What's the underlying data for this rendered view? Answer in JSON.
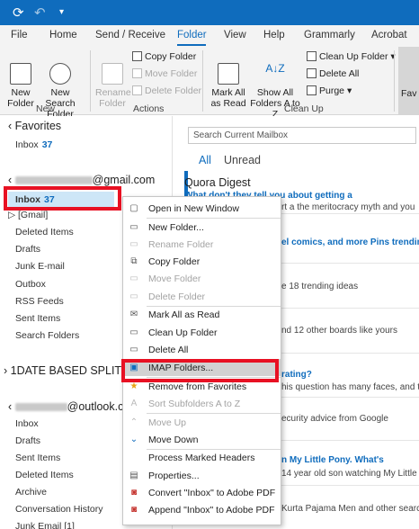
{
  "colors": {
    "accent": "#0f6cbd",
    "highlight_outline": "#e81123",
    "titlebar": "#0f6cbd"
  },
  "menu_tabs": [
    "File",
    "Home",
    "Send / Receive",
    "Folder",
    "View",
    "Help",
    "Grammarly",
    "Acrobat"
  ],
  "active_tab": "Folder",
  "ribbon": {
    "new_folder": "New\nFolder",
    "new_search_folder": "New Search\nFolder",
    "rename_folder": "Rename\nFolder",
    "copy_folder": "Copy Folder",
    "move_folder": "Move Folder",
    "delete_folder": "Delete Folder",
    "mark_all_as_read": "Mark All\nas Read",
    "show_all_folders": "Show All\nFolders A to Z",
    "clean_up_folder": "Clean Up Folder",
    "delete_all": "Delete All",
    "purge": "Purge",
    "group_new": "New",
    "group_actions": "Actions",
    "group_clean_up": "Clean Up",
    "fav_partial": "Fav"
  },
  "folder_pane": {
    "favorites": "Favorites",
    "fav_inbox": "Inbox",
    "fav_inbox_count": "37",
    "account1_suffix": "@gmail.com",
    "inbox": "Inbox",
    "inbox_count": "37",
    "gmail": "[Gmail]",
    "deleted_items": "Deleted Items",
    "drafts": "Drafts",
    "junk": "Junk E-mail",
    "outbox": "Outbox",
    "rss": "RSS Feeds",
    "sent": "Sent Items",
    "search_folders": "Search Folders",
    "date_split": "1DATE BASED SPLIT",
    "account2_suffix": "@outlook.com",
    "inbox2": "Inbox",
    "drafts2": "Drafts",
    "sent2": "Sent Items",
    "deleted2": "Deleted Items",
    "archive": "Archive",
    "conv_history": "Conversation History",
    "junk2": "Junk Email [1]"
  },
  "main": {
    "search_placeholder": "Search Current Mailbox",
    "filter_all": "All",
    "filter_unread": "Unread",
    "sender1": "Quora Digest",
    "subject1": "What don't they tell you about getting a",
    "preview1": "rt a the meritocracy myth and you",
    "row2": "el comics, and more Pins trending on",
    "row3": "e 18 trending ideas",
    "row4": "nd 12 other boards like yours",
    "row5": "rating?",
    "row6": "his question has many faces, and th",
    "row7": "ecurity advice from Google",
    "row8": "n My Little Pony. What's",
    "row9": "14 year old son watching My Little",
    "row10": "Kurta Pajama Men and other search"
  },
  "context_menu": [
    {
      "label": "Open in New Window",
      "icon": "open-window-icon",
      "enabled": true
    },
    {
      "label": "New Folder...",
      "icon": "new-folder-icon",
      "enabled": true
    },
    {
      "label": "Rename Folder",
      "icon": "rename-icon",
      "enabled": false
    },
    {
      "label": "Copy Folder",
      "icon": "copy-folder-icon",
      "enabled": true
    },
    {
      "label": "Move Folder",
      "icon": "move-folder-icon",
      "enabled": false
    },
    {
      "label": "Delete Folder",
      "icon": "delete-folder-icon",
      "enabled": false
    },
    {
      "label": "Mark All as Read",
      "icon": "mark-read-icon",
      "enabled": true
    },
    {
      "label": "Clean Up Folder",
      "icon": "clean-up-icon",
      "enabled": true
    },
    {
      "label": "Delete All",
      "icon": "delete-all-icon",
      "enabled": true
    },
    {
      "label": "IMAP Folders...",
      "icon": "imap-icon",
      "enabled": true,
      "highlighted": true
    },
    {
      "label": "Remove from Favorites",
      "icon": "star-icon",
      "enabled": true
    },
    {
      "label": "Sort Subfolders A to Z",
      "icon": "sort-icon",
      "enabled": false
    },
    {
      "label": "Move Up",
      "icon": "chevron-up-icon",
      "enabled": false
    },
    {
      "label": "Move Down",
      "icon": "chevron-down-icon",
      "enabled": true
    },
    {
      "label": "Process Marked Headers",
      "icon": "none",
      "enabled": true
    },
    {
      "label": "Properties...",
      "icon": "properties-icon",
      "enabled": true
    },
    {
      "label": "Convert \"Inbox\" to Adobe PDF",
      "icon": "pdf-icon",
      "enabled": true
    },
    {
      "label": "Append \"Inbox\" to Adobe PDF",
      "icon": "pdf-icon",
      "enabled": true
    }
  ]
}
